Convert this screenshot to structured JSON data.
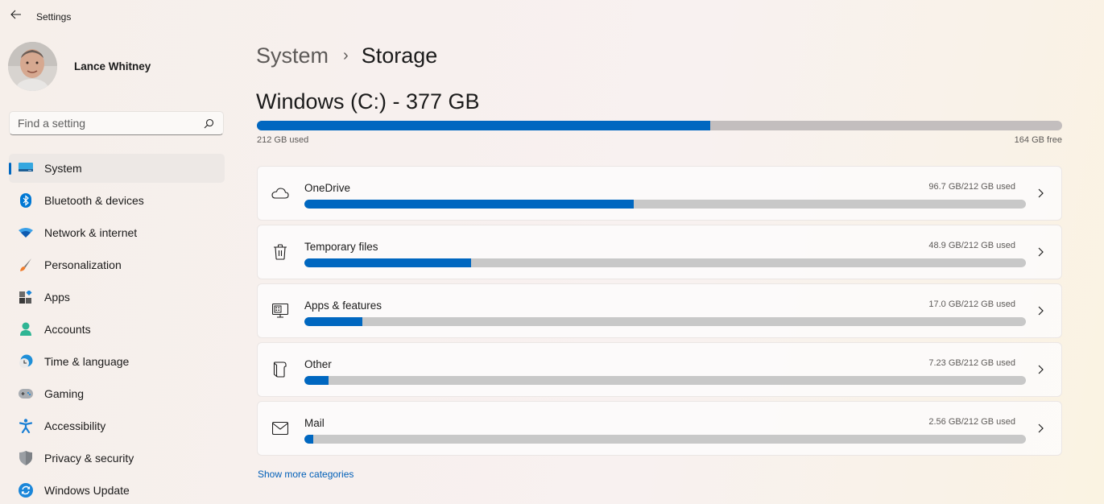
{
  "window": {
    "title": "Settings",
    "back_icon": "arrow-left-icon"
  },
  "profile": {
    "name": "Lance Whitney",
    "avatar_icon": "user-avatar-photo"
  },
  "search": {
    "placeholder": "Find a setting",
    "value": "",
    "icon": "search-icon"
  },
  "sidebar": {
    "items": [
      {
        "label": "System",
        "icon": "system-display-icon",
        "active": true
      },
      {
        "label": "Bluetooth & devices",
        "icon": "bluetooth-icon",
        "active": false
      },
      {
        "label": "Network & internet",
        "icon": "wifi-icon",
        "active": false
      },
      {
        "label": "Personalization",
        "icon": "paintbrush-icon",
        "active": false
      },
      {
        "label": "Apps",
        "icon": "apps-icon",
        "active": false
      },
      {
        "label": "Accounts",
        "icon": "person-icon",
        "active": false
      },
      {
        "label": "Time & language",
        "icon": "globe-clock-icon",
        "active": false
      },
      {
        "label": "Gaming",
        "icon": "gamepad-icon",
        "active": false
      },
      {
        "label": "Accessibility",
        "icon": "accessibility-icon",
        "active": false
      },
      {
        "label": "Privacy & security",
        "icon": "shield-icon",
        "active": false
      },
      {
        "label": "Windows Update",
        "icon": "sync-icon",
        "active": false
      }
    ]
  },
  "breadcrumb": {
    "parent": "System",
    "separator": "›",
    "current": "Storage"
  },
  "drive": {
    "title": "Windows (C:) - 377 GB",
    "used_label": "212 GB used",
    "free_label": "164 GB free",
    "used_fraction": 0.563
  },
  "categories": [
    {
      "name": "OneDrive",
      "usage": "96.7 GB/212 GB used",
      "fraction": 0.456,
      "icon": "cloud-icon"
    },
    {
      "name": "Temporary files",
      "usage": "48.9 GB/212 GB used",
      "fraction": 0.231,
      "icon": "trash-icon"
    },
    {
      "name": "Apps & features",
      "usage": "17.0 GB/212 GB used",
      "fraction": 0.08,
      "icon": "apps-monitor-icon"
    },
    {
      "name": "Other",
      "usage": "7.23 GB/212 GB used",
      "fraction": 0.034,
      "icon": "document-icon"
    },
    {
      "name": "Mail",
      "usage": "2.56 GB/212 GB used",
      "fraction": 0.012,
      "icon": "mail-icon"
    }
  ],
  "show_more": "Show more categories",
  "colors": {
    "accent": "#0067c0",
    "bar_track": "#c8c8c8",
    "link": "#005fb8"
  }
}
